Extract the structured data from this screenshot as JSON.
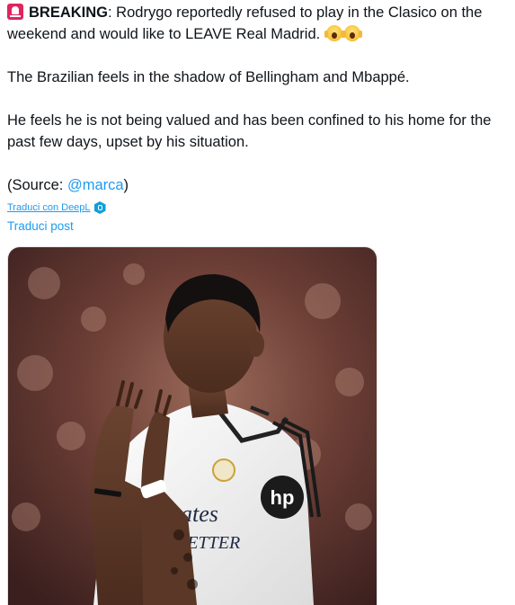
{
  "tweet": {
    "breaking_label": "BREAKING",
    "line1_rest": ": Rodrygo reportedly refused to play in the Clasico on the weekend and would like to LEAVE Real Madrid.",
    "paragraph2": "The Brazilian feels in the shadow of Bellingham and Mbappé.",
    "paragraph3": "He feels he is not being valued and has been confined to his home for the past few days, upset by his situation.",
    "source_prefix": "(Source: ",
    "source_mention": "@marca",
    "source_suffix": ")",
    "icons": [
      "rotating-light-icon",
      "screaming-face-icon",
      "screaming-face-icon"
    ]
  },
  "deepl": {
    "link_label": "Traduci con DeepL",
    "icon": "deepl-icon"
  },
  "translate_post_label": "Traduci post",
  "media": {
    "jersey_text_line1": "Emirates",
    "jersey_text_line2": "FLY BETTER",
    "sponsor_badge": "hp"
  },
  "colors": {
    "text": "#0f1419",
    "link": "#1d9bf0",
    "alert_red": "#e0245e"
  }
}
